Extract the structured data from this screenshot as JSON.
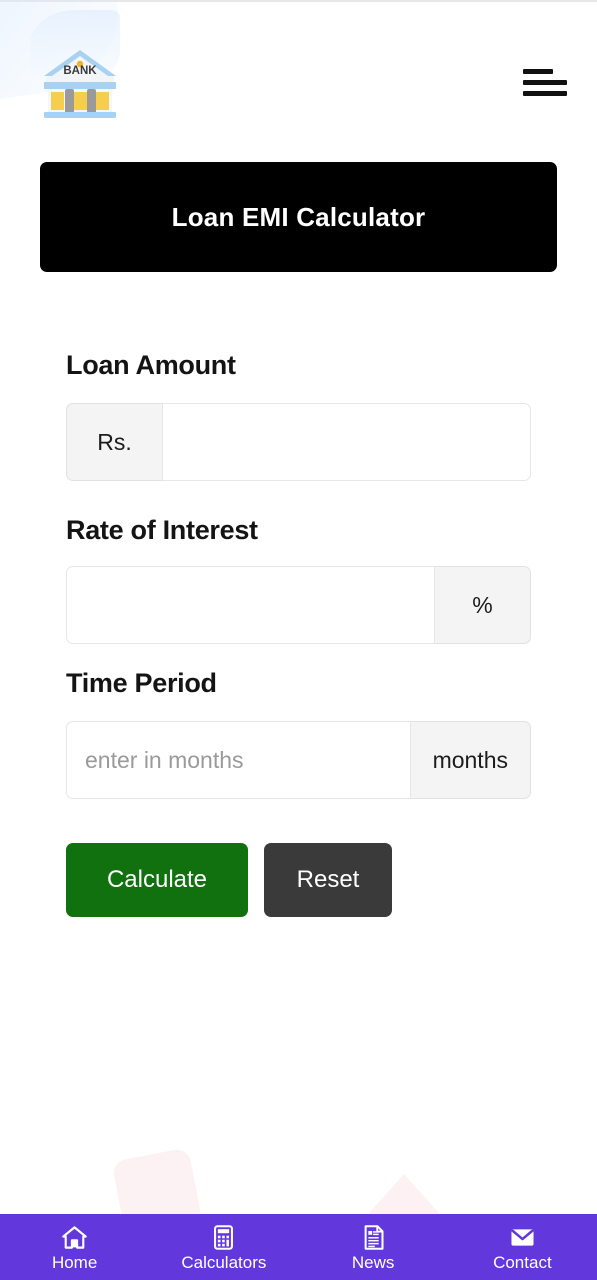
{
  "header": {
    "logo_alt": "Bank logo",
    "logo_text": "BANK",
    "menu_icon": "hamburger-menu-icon"
  },
  "main": {
    "title": "Loan EMI Calculator",
    "fields": [
      {
        "label": "Loan Amount",
        "addon": "Rs.",
        "addon_side": "left",
        "value": "",
        "placeholder": ""
      },
      {
        "label": "Rate of Interest",
        "addon": "%",
        "addon_side": "right",
        "value": "",
        "placeholder": ""
      },
      {
        "label": "Time Period",
        "addon": "months",
        "addon_side": "right",
        "value": "",
        "placeholder": "enter in months"
      }
    ],
    "buttons": {
      "calculate": "Calculate",
      "reset": "Reset"
    }
  },
  "bottom_nav": {
    "items": [
      {
        "label": "Home",
        "icon": "home-icon"
      },
      {
        "label": "Calculators",
        "icon": "calculator-icon"
      },
      {
        "label": "News",
        "icon": "document-icon"
      },
      {
        "label": "Contact",
        "icon": "envelope-icon"
      }
    ]
  },
  "colors": {
    "banner_bg": "#000000",
    "calculate_bg": "#11710e",
    "reset_bg": "#3a3a3a",
    "nav_bg": "#6237dc",
    "addon_bg": "#f4f4f4"
  }
}
